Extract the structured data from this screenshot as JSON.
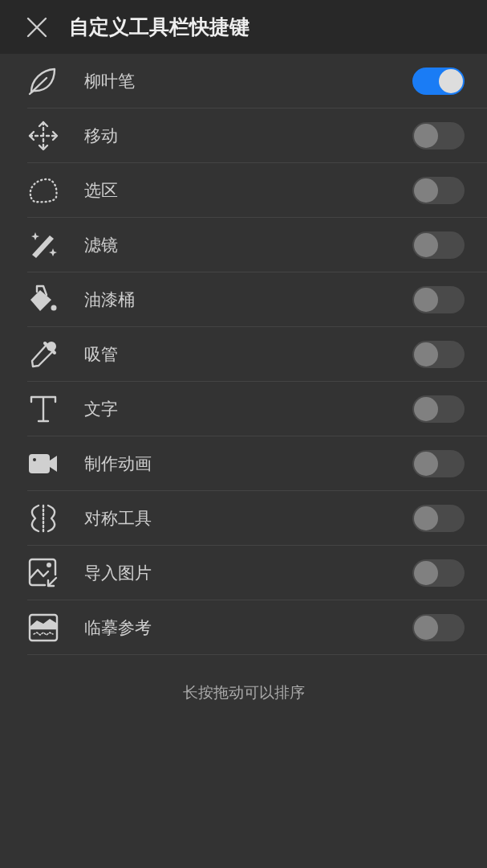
{
  "header": {
    "title": "自定义工具栏快捷键"
  },
  "tools": [
    {
      "label": "柳叶笔",
      "on": true
    },
    {
      "label": "移动",
      "on": false
    },
    {
      "label": "选区",
      "on": false
    },
    {
      "label": "滤镜",
      "on": false
    },
    {
      "label": "油漆桶",
      "on": false
    },
    {
      "label": "吸管",
      "on": false
    },
    {
      "label": "文字",
      "on": false
    },
    {
      "label": "制作动画",
      "on": false
    },
    {
      "label": "对称工具",
      "on": false
    },
    {
      "label": "导入图片",
      "on": false
    },
    {
      "label": "临摹参考",
      "on": false
    }
  ],
  "hint": "长按拖动可以排序"
}
